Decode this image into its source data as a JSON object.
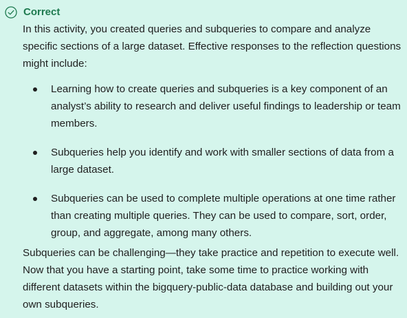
{
  "status": {
    "label": "Correct",
    "icon": "check-circle-icon",
    "color": "#1e7a4f"
  },
  "intro": "In this activity, you created queries and subqueries to compare and analyze specific sections of a large dataset. Effective responses to the reflection questions might include:",
  "bullets": [
    "Learning how to create queries and subqueries is a key component of an analyst’s ability to research and deliver useful findings to leadership or team members.",
    "Subqueries help you identify and work with smaller sections of data from a large dataset.",
    "Subqueries can be used to complete multiple operations at one time rather than creating multiple queries.  They can be used to compare, sort, order, group, and aggregate, among many others."
  ],
  "outro": "Subqueries can be challenging—they take practice and repetition to execute well. Now that you have a starting point, take some time to practice working with different datasets within the bigquery-public-data database and building out your own subqueries.",
  "colors": {
    "background": "#d5f5ec",
    "text": "#1f1f1f"
  }
}
